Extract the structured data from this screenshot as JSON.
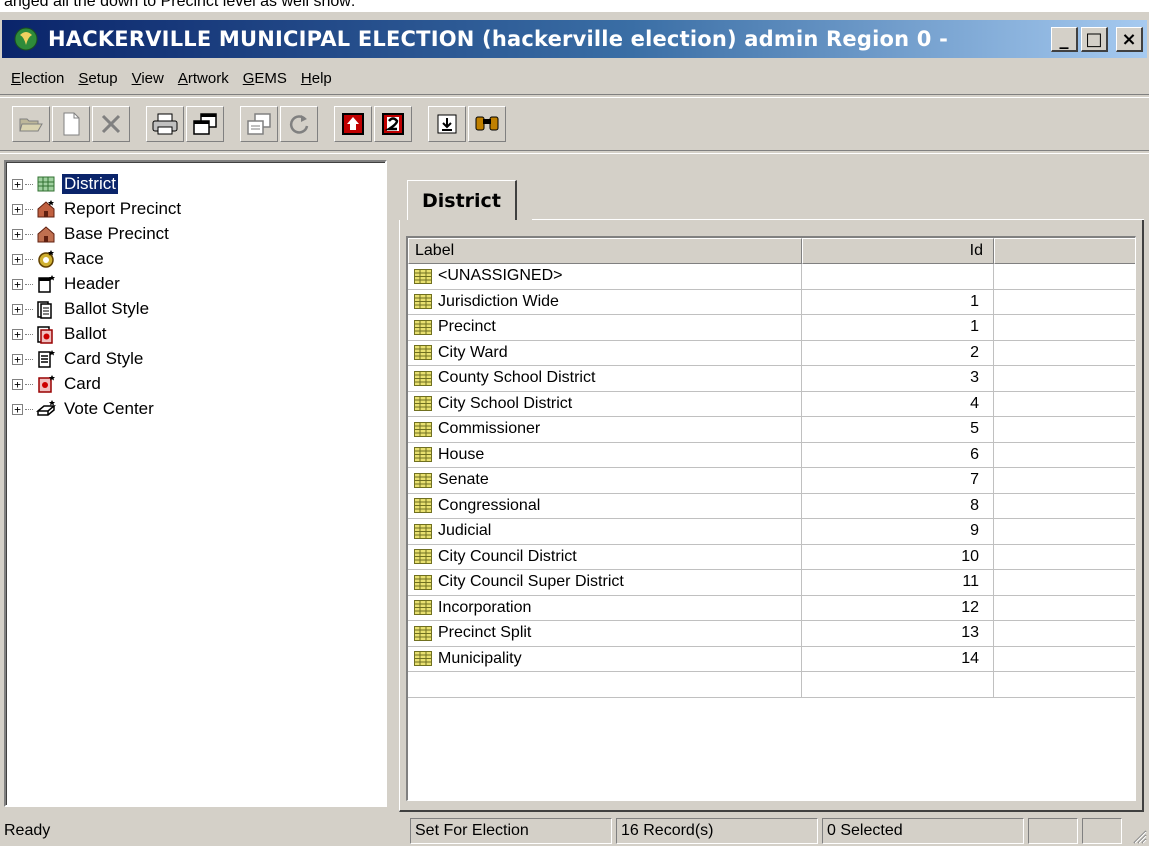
{
  "page_caption": "anged all the down to Precinct level as well show:",
  "window": {
    "title_main": "HACKERVILLE MUNICIPAL ELECTION (hackerville election) admin Region 0 -",
    "minimize_label": "_",
    "maximize_label": "□",
    "close_label": "×"
  },
  "menu": [
    {
      "accel": "E",
      "rest": "lection"
    },
    {
      "accel": "S",
      "rest": "etup"
    },
    {
      "accel": "V",
      "rest": "iew"
    },
    {
      "accel": "A",
      "rest": "rtwork"
    },
    {
      "accel": "G",
      "rest": "EMS"
    },
    {
      "accel": "H",
      "rest": "elp"
    }
  ],
  "toolbar": {
    "buttons": [
      "open-icon",
      "new-icon",
      "delete-icon",
      "print-icon",
      "cascade-icon",
      "copy-window-icon",
      "refresh-icon",
      "stop-icon",
      "number-two-icon",
      "export-icon",
      "find-icon"
    ]
  },
  "tree": {
    "items": [
      {
        "label": "District",
        "icon": "district-icon",
        "selected": true
      },
      {
        "label": "Report Precinct",
        "icon": "report-precinct-icon"
      },
      {
        "label": "Base Precinct",
        "icon": "base-precinct-icon"
      },
      {
        "label": "Race",
        "icon": "race-icon"
      },
      {
        "label": "Header",
        "icon": "header-icon"
      },
      {
        "label": "Ballot Style",
        "icon": "ballot-style-icon"
      },
      {
        "label": "Ballot",
        "icon": "ballot-icon"
      },
      {
        "label": "Card Style",
        "icon": "card-style-icon"
      },
      {
        "label": "Card",
        "icon": "card-icon"
      },
      {
        "label": "Vote Center",
        "icon": "vote-center-icon"
      }
    ],
    "expander": "+"
  },
  "tab": {
    "label": "District"
  },
  "grid": {
    "columns": [
      "Label",
      "Id"
    ],
    "rows": [
      {
        "label": "<UNASSIGNED>",
        "id": ""
      },
      {
        "label": "Jurisdiction Wide",
        "id": "1"
      },
      {
        "label": "Precinct",
        "id": "1"
      },
      {
        "label": "City Ward",
        "id": "2"
      },
      {
        "label": "County School District",
        "id": "3"
      },
      {
        "label": "City School District",
        "id": "4"
      },
      {
        "label": "Commissioner",
        "id": "5"
      },
      {
        "label": "House",
        "id": "6"
      },
      {
        "label": "Senate",
        "id": "7"
      },
      {
        "label": "Congressional",
        "id": "8"
      },
      {
        "label": "Judicial",
        "id": "9"
      },
      {
        "label": "City Council District",
        "id": "10"
      },
      {
        "label": "City Council Super District",
        "id": "11"
      },
      {
        "label": "Incorporation",
        "id": "12"
      },
      {
        "label": "Precinct Split",
        "id": "13"
      },
      {
        "label": "Municipality",
        "id": "14"
      }
    ]
  },
  "status": {
    "ready": "Ready",
    "mode": "Set For Election",
    "records": "16 Record(s)",
    "selected": "0 Selected"
  }
}
